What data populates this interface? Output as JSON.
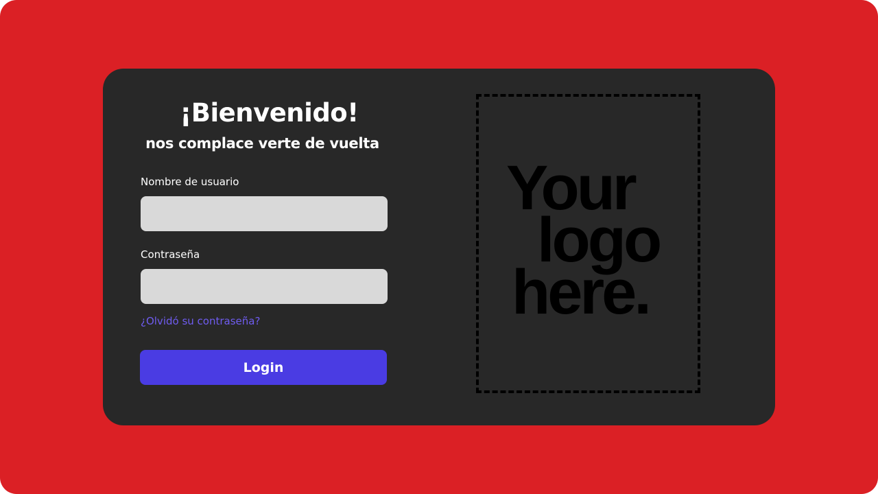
{
  "colors": {
    "page_background": "#db2025",
    "card_background": "#282828",
    "input_background": "#d9d9d9",
    "link": "#6f5cf0",
    "button": "#4a3ce3"
  },
  "login_form": {
    "title": "¡Bienvenido!",
    "subtitle": "nos complace verte de vuelta",
    "username": {
      "label": "Nombre de usuario",
      "value": ""
    },
    "password": {
      "label": "Contraseña",
      "value": ""
    },
    "forgot_password_link": "¿Olvidó su contraseña?",
    "login_button": "Login"
  },
  "logo_placeholder": {
    "lines": [
      "Your",
      "logo",
      "here."
    ]
  }
}
